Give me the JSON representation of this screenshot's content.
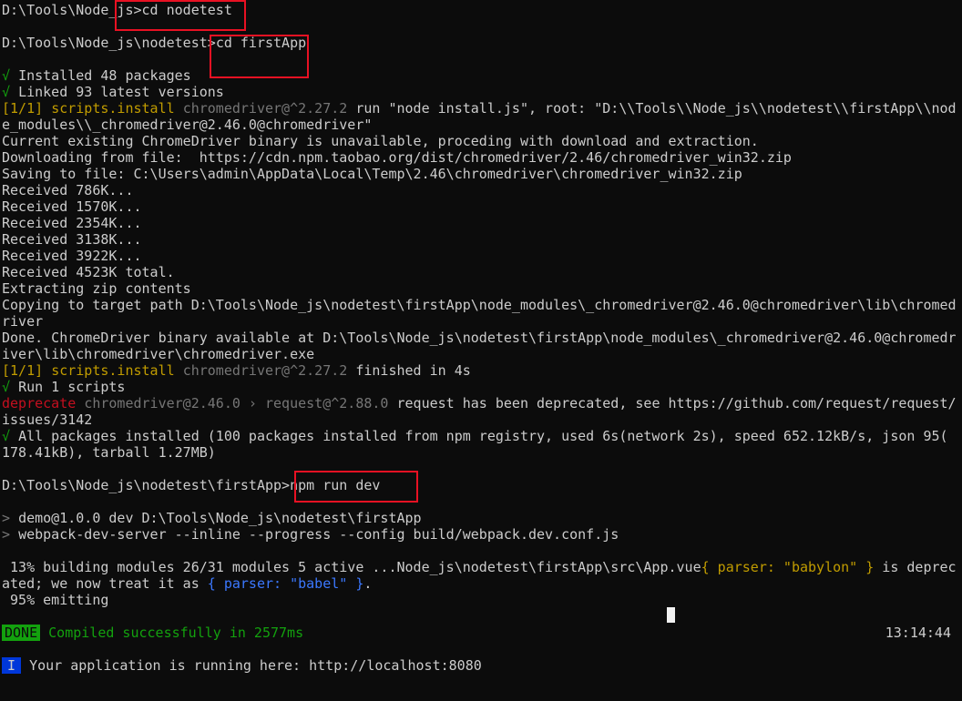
{
  "cmd1": {
    "prompt": "D:\\Tools\\Node_js>",
    "command": "cd nodetest"
  },
  "cmd2": {
    "prompt": "D:\\Tools\\Node_js\\nodetest>",
    "command": "cd firstApp"
  },
  "install": {
    "check": "√",
    "installed": "Installed 48 packages",
    "linked": "Linked 93 latest versions"
  },
  "script1": {
    "tag": "[1/1]",
    "name": "scripts.install",
    "pkg": "chromedriver@^2.27.2",
    "rest": "run \"node install.js\", root: \"D:\\\\Tools\\\\Node_js\\\\nodetest\\\\firstApp\\\\nod",
    "wrap": "e_modules\\\\_chromedriver@2.46.0@chromedriver\""
  },
  "log": [
    "Current existing ChromeDriver binary is unavailable, proceding with download and extraction.",
    "Downloading from file:  https://cdn.npm.taobao.org/dist/chromedriver/2.46/chromedriver_win32.zip",
    "Saving to file: C:\\Users\\admin\\AppData\\Local\\Temp\\2.46\\chromedriver\\chromedriver_win32.zip",
    "Received 786K...",
    "Received 1570K...",
    "Received 2354K...",
    "Received 3138K...",
    "Received 3922K...",
    "Received 4523K total.",
    "Extracting zip contents",
    "Copying to target path D:\\Tools\\Node_js\\nodetest\\firstApp\\node_modules\\_chromedriver@2.46.0@chromedriver\\lib\\chromed",
    "river",
    "Done. ChromeDriver binary available at D:\\Tools\\Node_js\\nodetest\\firstApp\\node_modules\\_chromedriver@2.46.0@chromedr",
    "iver\\lib\\chromedriver\\chromedriver.exe"
  ],
  "script2": {
    "tag": "[1/1]",
    "name": "scripts.install",
    "pkg": "chromedriver@^2.27.2",
    "rest": "finished in 4s"
  },
  "run": {
    "check": "√",
    "text": "Run 1 scripts"
  },
  "deprecate": {
    "label": "deprecate",
    "pkg": "chromedriver@2.46.0 › request@^2.88.0",
    "rest": "request has been deprecated, see https://github.com/request/request/",
    "wrap": "issues/3142"
  },
  "all": {
    "check": "√",
    "text": "All packages installed (100 packages installed from npm registry, used 6s(network 2s), speed 652.12kB/s, json 95(",
    "wrap": "178.41kB), tarball 1.27MB)"
  },
  "cmd3": {
    "prompt": "D:\\Tools\\Node_js\\nodetest\\firstApp>",
    "command": "npm run dev"
  },
  "npm": {
    "gt": ">",
    "l1": "demo@1.0.0 dev D:\\Tools\\Node_js\\nodetest\\firstApp",
    "l2": "webpack-dev-server --inline --progress --config build/webpack.dev.conf.js"
  },
  "build": {
    "l1": " 13% building modules 26/31 modules 5 active ...Node_js\\nodetest\\firstApp\\src\\App.vue",
    "parser1": "{ parser: \"babylon\" }",
    "l1b": " is deprec",
    "l2": "ated; we now treat it as ",
    "parser2": "{ parser: \"babel\" }",
    "l2b": ".",
    "l3": " 95% emitting"
  },
  "done": {
    "badge": "DONE",
    "text": "Compiled successfully in 2577ms",
    "time": "13:14:44"
  },
  "info": {
    "badge": "I",
    "text": "Your application is running here: http://localhost:8080"
  },
  "colors": {
    "background": "#0c0c0c",
    "text": "#cccccc",
    "green": "#13a10e",
    "yellow": "#c19c00",
    "gray": "#767676",
    "red": "#c50f1f",
    "blue": "#3b78ff",
    "highlight": "#e81123"
  }
}
